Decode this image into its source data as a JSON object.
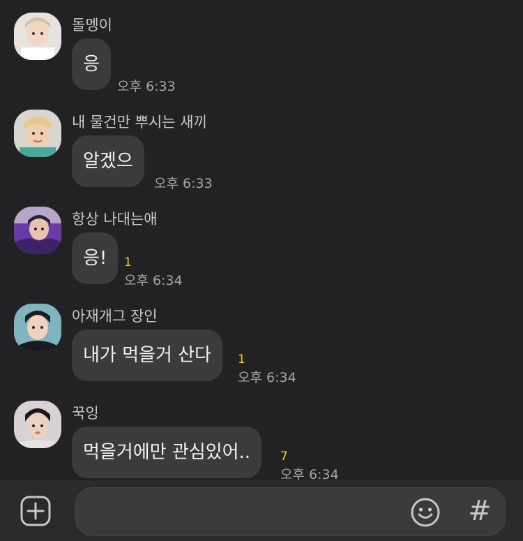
{
  "messages": [
    {
      "sender": "돌멩이",
      "text": "응",
      "time": "오후 6:33",
      "unread": "",
      "avatar": "avatar-1"
    },
    {
      "sender": "내 물건만 뿌시는 새끼",
      "text": "알겠으",
      "time": "오후 6:33",
      "unread": "",
      "avatar": "avatar-2"
    },
    {
      "sender": "항상 나대는애",
      "text": "응!",
      "time": "오후 6:34",
      "unread": "1",
      "avatar": "avatar-3"
    },
    {
      "sender": "아재개그 장인",
      "text": "내가 먹을거 산다",
      "time": "오후 6:34",
      "unread": "1",
      "avatar": "avatar-4"
    },
    {
      "sender": "꾹잉",
      "text": "먹을거에만 관심있어..",
      "time": "오후 6:34",
      "unread": "7",
      "avatar": "avatar-5"
    }
  ],
  "composer": {
    "input_value": "",
    "icons": {
      "add": "plus-square-icon",
      "emoji": "smiley-icon",
      "hashtag": "hashtag-icon"
    },
    "hash_glyph": "#"
  },
  "colors": {
    "background": "#222224",
    "bubble": "#3b3b3e",
    "unread": "#f5cf1b",
    "composer": "#2a2a2c"
  }
}
